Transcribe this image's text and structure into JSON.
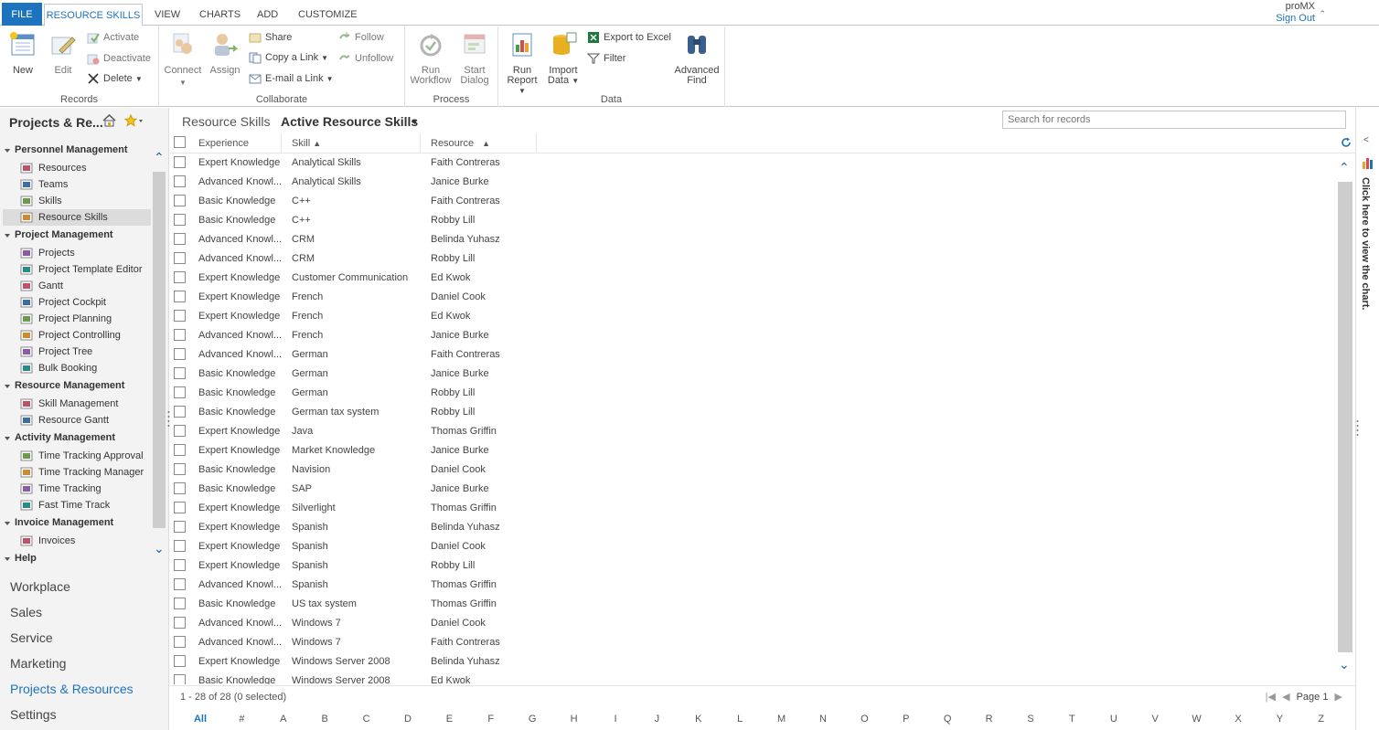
{
  "tabs": {
    "file": "FILE",
    "active": "RESOURCE SKILLS",
    "view": "VIEW",
    "charts": "CHARTS",
    "add": "ADD",
    "customize": "CUSTOMIZE"
  },
  "user": {
    "org": "proMX",
    "signout": "Sign Out"
  },
  "ribbon": {
    "records": {
      "label": "Records",
      "new": "New",
      "edit": "Edit",
      "activate": "Activate",
      "deactivate": "Deactivate",
      "delete": "Delete"
    },
    "collaborate": {
      "label": "Collaborate",
      "connect": "Connect",
      "assign": "Assign",
      "share": "Share",
      "copy_link": "Copy a Link",
      "email_link": "E-mail a Link",
      "follow": "Follow",
      "unfollow": "Unfollow"
    },
    "process": {
      "label": "Process",
      "run_workflow_1": "Run",
      "run_workflow_2": "Workflow",
      "start_dialog_1": "Start",
      "start_dialog_2": "Dialog"
    },
    "data": {
      "label": "Data",
      "run_report_1": "Run",
      "run_report_2": "Report",
      "import_data_1": "Import",
      "import_data_2": "Data",
      "export_excel": "Export to Excel",
      "filter": "Filter",
      "advanced_find_1": "Advanced",
      "advanced_find_2": "Find"
    }
  },
  "nav": {
    "title": "Projects & Re...",
    "groups": [
      {
        "label": "Personnel Management",
        "items": [
          "Resources",
          "Teams",
          "Skills",
          "Resource Skills"
        ]
      },
      {
        "label": "Project Management",
        "items": [
          "Projects",
          "Project Template Editor",
          "Gantt",
          "Project Cockpit",
          "Project Planning",
          "Project Controlling",
          "Project Tree",
          "Bulk Booking"
        ]
      },
      {
        "label": "Resource Management",
        "items": [
          "Skill Management",
          "Resource Gantt"
        ]
      },
      {
        "label": "Activity Management",
        "items": [
          "Time Tracking Approval",
          "Time Tracking Manager",
          "Time Tracking",
          "Fast Time Track"
        ]
      },
      {
        "label": "Invoice Management",
        "items": [
          "Invoices"
        ]
      },
      {
        "label": "Help",
        "items": []
      }
    ],
    "selected": "Resource Skills",
    "areas": [
      "Workplace",
      "Sales",
      "Service",
      "Marketing",
      "Projects & Resources",
      "Settings"
    ],
    "active_area": "Projects & Resources"
  },
  "view": {
    "entity": "Resource Skills",
    "name": "Active Resource Skills",
    "search_placeholder": "Search for records"
  },
  "grid": {
    "columns": [
      "Experience",
      "Skill",
      "Resource"
    ],
    "rows": [
      [
        "Expert Knowledge",
        "Analytical Skills",
        "Faith Contreras"
      ],
      [
        "Advanced Knowl...",
        "Analytical Skills",
        "Janice Burke"
      ],
      [
        "Basic Knowledge",
        "C++",
        "Faith Contreras"
      ],
      [
        "Basic Knowledge",
        "C++",
        "Robby Lill"
      ],
      [
        "Advanced Knowl...",
        "CRM",
        "Belinda Yuhasz"
      ],
      [
        "Advanced Knowl...",
        "CRM",
        "Robby Lill"
      ],
      [
        "Expert Knowledge",
        "Customer Communication",
        "Ed Kwok"
      ],
      [
        "Expert Knowledge",
        "French",
        "Daniel Cook"
      ],
      [
        "Expert Knowledge",
        "French",
        "Ed Kwok"
      ],
      [
        "Advanced Knowl...",
        "French",
        "Janice Burke"
      ],
      [
        "Advanced Knowl...",
        "German",
        "Faith Contreras"
      ],
      [
        "Basic Knowledge",
        "German",
        "Janice Burke"
      ],
      [
        "Basic Knowledge",
        "German",
        "Robby Lill"
      ],
      [
        "Basic Knowledge",
        "German tax system",
        "Robby Lill"
      ],
      [
        "Expert Knowledge",
        "Java",
        "Thomas Griffin"
      ],
      [
        "Expert Knowledge",
        "Market Knowledge",
        "Janice Burke"
      ],
      [
        "Basic Knowledge",
        "Navision",
        "Daniel Cook"
      ],
      [
        "Basic Knowledge",
        "SAP",
        "Janice Burke"
      ],
      [
        "Expert Knowledge",
        "Silverlight",
        "Thomas Griffin"
      ],
      [
        "Expert Knowledge",
        "Spanish",
        "Belinda Yuhasz"
      ],
      [
        "Expert Knowledge",
        "Spanish",
        "Daniel Cook"
      ],
      [
        "Expert Knowledge",
        "Spanish",
        "Robby Lill"
      ],
      [
        "Advanced Knowl...",
        "Spanish",
        "Thomas Griffin"
      ],
      [
        "Basic Knowledge",
        "US tax system",
        "Thomas Griffin"
      ],
      [
        "Advanced Knowl...",
        "Windows 7",
        "Daniel Cook"
      ],
      [
        "Advanced Knowl...",
        "Windows 7",
        "Faith Contreras"
      ],
      [
        "Expert Knowledge",
        "Windows Server 2008",
        "Belinda Yuhasz"
      ],
      [
        "Basic Knowledge",
        "Windows Server 2008",
        "Ed Kwok"
      ]
    ],
    "record_count": "1 - 28 of 28 (0 selected)",
    "page": "Page 1",
    "letters": [
      "All",
      "#",
      "A",
      "B",
      "C",
      "D",
      "E",
      "F",
      "G",
      "H",
      "I",
      "J",
      "K",
      "L",
      "M",
      "N",
      "O",
      "P",
      "Q",
      "R",
      "S",
      "T",
      "U",
      "V",
      "W",
      "X",
      "Y",
      "Z"
    ],
    "active_letter": "All"
  },
  "chart_pane": {
    "label": "Click here to view the chart."
  },
  "colors": {
    "accent": "#1e73be",
    "selected_row": "#dcdcdc",
    "nav_bg": "#f3f3f3"
  }
}
